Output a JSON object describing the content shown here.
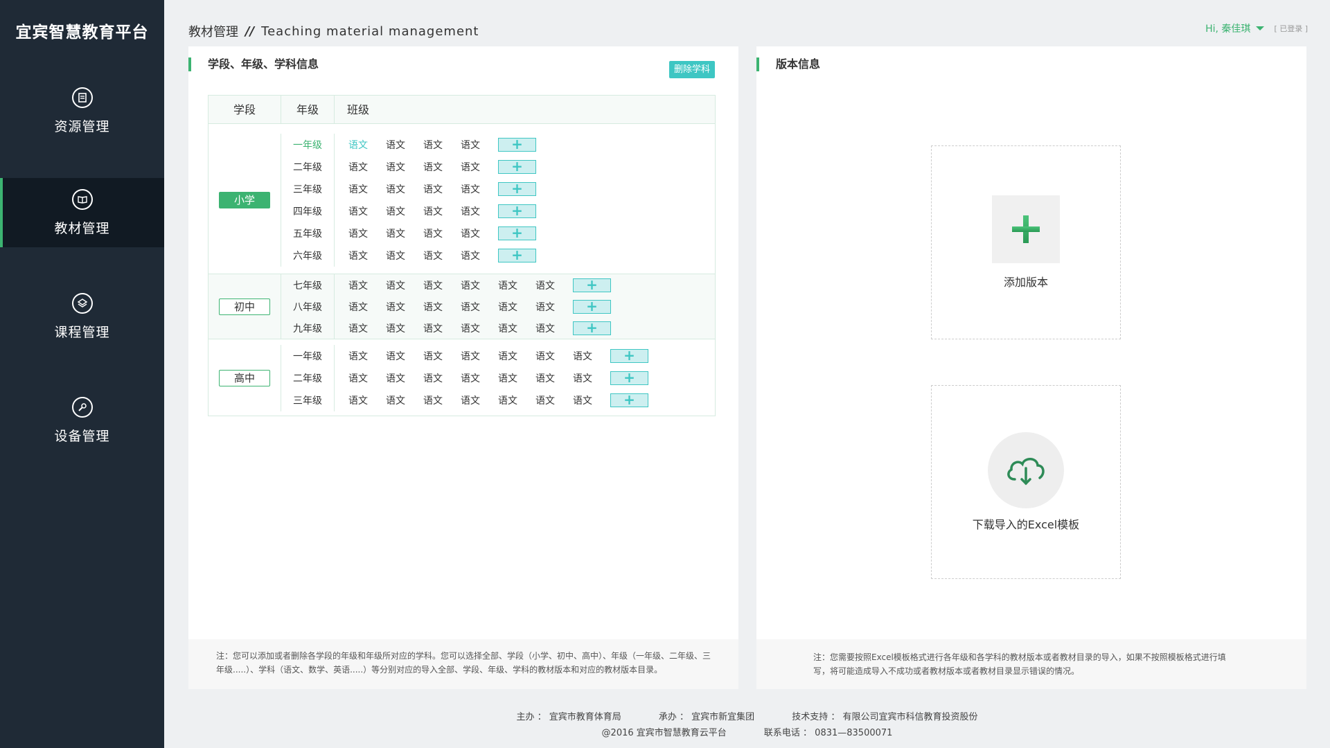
{
  "app": {
    "logo_text": "宜宾智慧教育平台"
  },
  "sidebar": {
    "items": [
      {
        "label": "资源管理",
        "icon": "document-icon"
      },
      {
        "label": "教材管理",
        "icon": "book-icon"
      },
      {
        "label": "课程管理",
        "icon": "layers-icon"
      },
      {
        "label": "设备管理",
        "icon": "wrench-icon"
      }
    ],
    "active_index": 1
  },
  "header": {
    "title_cn": "教材管理",
    "separator": "//",
    "title_en": "Teaching material management",
    "user_greeting": "Hi, 秦佳琪",
    "login_status": "[ 已登录 ]"
  },
  "left_panel": {
    "title": "学段、年级、学科信息",
    "delete_button": "删除学科",
    "table_headers": {
      "stage": "学段",
      "grade": "年级",
      "subject": "班级"
    },
    "add_symbol": "+",
    "groups": [
      {
        "stage": "小学",
        "active": true,
        "grades": [
          "一年级",
          "二年级",
          "三年级",
          "四年级",
          "五年级",
          "六年级"
        ],
        "subjects_per_row": [
          "语文",
          "语文",
          "语文",
          "语文"
        ]
      },
      {
        "stage": "初中",
        "active": false,
        "grades": [
          "七年级",
          "八年级",
          "九年级"
        ],
        "subjects_per_row": [
          "语文",
          "语文",
          "语文",
          "语文",
          "语文",
          "语文"
        ]
      },
      {
        "stage": "高中",
        "active": false,
        "grades": [
          "一年级",
          "二年级",
          "三年级"
        ],
        "subjects_per_row": [
          "语文",
          "语文",
          "语文",
          "语文",
          "语文",
          "语文",
          "语文"
        ]
      }
    ],
    "note": "注：您可以添加或者删除各学段的年级和年级所对应的学科。您可以选择全部、学段（小学、初中、高中）、年级（一年级、二年级、三年级.....）、学科（语文、数学、英语.....）等分别对应的导入全部、学段、年级、学科的教材版本和对应的教材版本目录。"
  },
  "right_panel": {
    "title": "版本信息",
    "add_version_label": "添加版本",
    "download_label": "下载导入的Excel模板",
    "note": "注：您需要按照Excel模板格式进行各年级和各学科的教材版本或者教材目录的导入，如果不按照模板格式进行填写，将可能造成导入不成功或者教材版本或者教材目录显示错误的情况。"
  },
  "footer": {
    "host": "主办 ： 宜宾市教育体育局",
    "organizer": "承办 ： 宜宾市新宜集团",
    "tech_support": "技术支持 ： 有限公司宜宾市科信教育投资股份",
    "copyright": "@2016  宜宾市智慧教育云平台",
    "phone": "联系电话 ： 0831—83500071"
  },
  "colors": {
    "accent": "#3cb371",
    "teal": "#3ec6c3",
    "sidebar": "#1f2a36"
  }
}
